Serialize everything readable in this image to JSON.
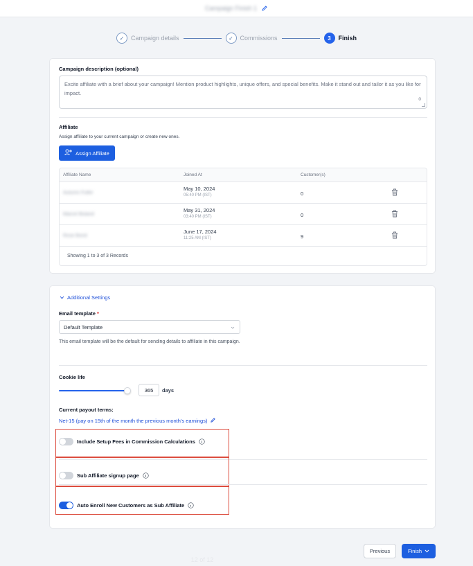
{
  "header": {
    "campaign_name": "Campaign Finish 1"
  },
  "stepper": {
    "steps": [
      {
        "label": "Campaign details",
        "state": "done"
      },
      {
        "label": "Commissions",
        "state": "done"
      },
      {
        "label": "Finish",
        "number": "3",
        "state": "active"
      }
    ]
  },
  "description": {
    "label": "Campaign description (optional)",
    "placeholder": "Excite affiliate with a brief about your campaign! Mention product highlights, unique offers, and special benefits. Make it stand out and tailor it as you like for impact.",
    "char_count": "0"
  },
  "affiliate": {
    "title": "Affiliate",
    "subtitle": "Assign affiliate to your current campaign or create new ones.",
    "assign_button": "Assign Affiliate",
    "columns": [
      "Affiliate Name",
      "Joined At",
      "Customer(s)"
    ],
    "rows": [
      {
        "name": "Autumn Fuller",
        "date": "May 10, 2024",
        "time": "05:40 PM (IST)",
        "customers": "0"
      },
      {
        "name": "Marcel Boland",
        "date": "May 31, 2024",
        "time": "03:40 PM (IST)",
        "customers": "0"
      },
      {
        "name": "Rose Bond",
        "date": "June 17, 2024",
        "time": "11:25 AM (IST)",
        "customers": "9"
      }
    ],
    "footer": "Showing 1 to 3 of 3 Records"
  },
  "additional": {
    "toggle_label": "Additional Settings",
    "email_label": "Email template",
    "required_mark": "*",
    "email_value": "Default Template",
    "email_help": "This email template will be the default for sending details to affiliate in this campaign.",
    "cookie_label": "Cookie life",
    "cookie_value": "365",
    "cookie_unit": "days",
    "cookie_slider_fraction": 1.0,
    "payout_label": "Current payout terms:",
    "payout_value": "Net-15 (pay on 15th of the month the previous month's earnings)",
    "toggles": [
      {
        "label": "Include Setup Fees in Commission Calculations",
        "on": false
      },
      {
        "label": "Sub Affiliate signup page",
        "on": false
      },
      {
        "label": "Auto Enroll New Customers as Sub Affiliate",
        "on": true
      }
    ]
  },
  "footer": {
    "previous": "Previous",
    "finish": "Finish",
    "page_indicator": "12 of 12"
  },
  "colors": {
    "accent": "#1d5fe0",
    "highlight": "#dc4c3e"
  }
}
